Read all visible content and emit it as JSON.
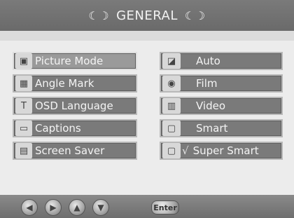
{
  "header": {
    "title": "GENERAL",
    "left_ornament": "☾☽",
    "right_ornament": "☾☽"
  },
  "left_menu": {
    "items": [
      {
        "label": "Picture Mode",
        "icon": "picture-mode-icon",
        "selected": true
      },
      {
        "label": "Angle Mark",
        "icon": "angle-mark-icon",
        "selected": false
      },
      {
        "label": "OSD Language",
        "icon": "osd-language-icon",
        "selected": false
      },
      {
        "label": "Captions",
        "icon": "captions-icon",
        "selected": false
      },
      {
        "label": "Screen Saver",
        "icon": "screen-saver-icon",
        "selected": false
      }
    ]
  },
  "right_menu": {
    "items": [
      {
        "label": "Auto",
        "icon": "auto-icon",
        "checked": false
      },
      {
        "label": "Film",
        "icon": "film-icon",
        "checked": false
      },
      {
        "label": "Video",
        "icon": "video-icon",
        "checked": false
      },
      {
        "label": "Smart",
        "icon": "smart-icon",
        "checked": false
      },
      {
        "label": "Super Smart",
        "icon": "super-smart-icon",
        "checked": true
      }
    ],
    "check_mark": "√"
  },
  "footer": {
    "enter_label": "Enter",
    "nav_buttons": [
      "arrow-left-icon",
      "arrow-right-icon",
      "arrow-up-icon",
      "arrow-down-icon"
    ]
  }
}
